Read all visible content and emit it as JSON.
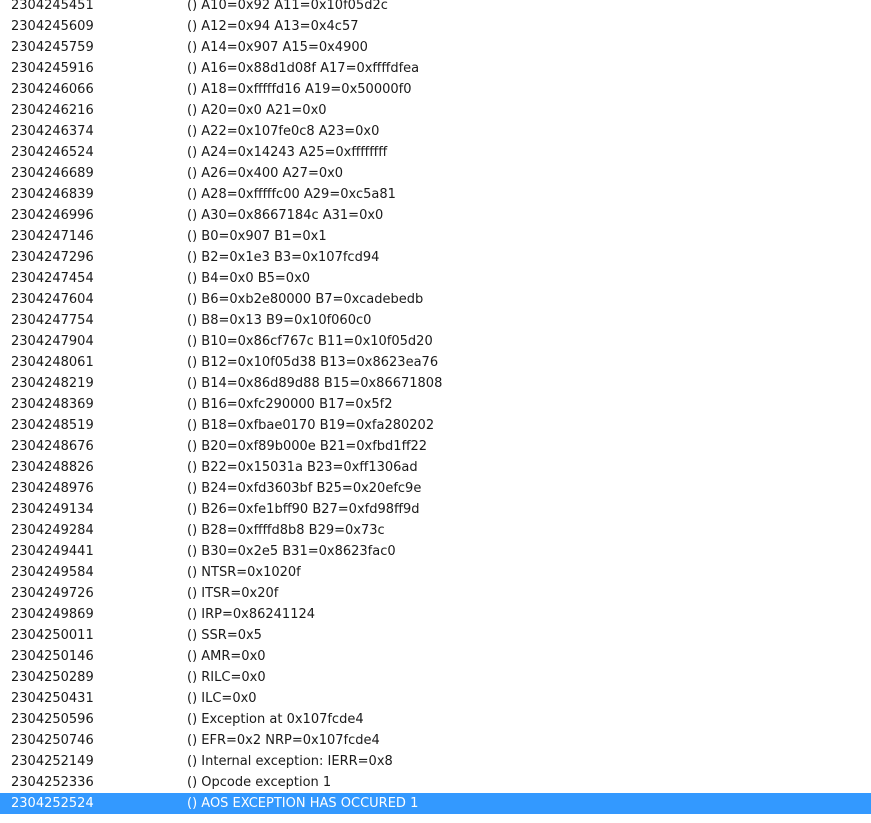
{
  "log": {
    "rows": [
      {
        "time": "2304245451",
        "message": "() A10=0x92 A11=0x10f05d2c"
      },
      {
        "time": "2304245609",
        "message": "() A12=0x94 A13=0x4c57"
      },
      {
        "time": "2304245759",
        "message": "() A14=0x907 A15=0x4900"
      },
      {
        "time": "2304245916",
        "message": "() A16=0x88d1d08f A17=0xffffdfea"
      },
      {
        "time": "2304246066",
        "message": "() A18=0xfffffd16 A19=0x50000f0"
      },
      {
        "time": "2304246216",
        "message": "() A20=0x0 A21=0x0"
      },
      {
        "time": "2304246374",
        "message": "() A22=0x107fe0c8 A23=0x0"
      },
      {
        "time": "2304246524",
        "message": "() A24=0x14243 A25=0xffffffff"
      },
      {
        "time": "2304246689",
        "message": "() A26=0x400 A27=0x0"
      },
      {
        "time": "2304246839",
        "message": "() A28=0xfffffc00 A29=0xc5a81"
      },
      {
        "time": "2304246996",
        "message": "() A30=0x8667184c A31=0x0"
      },
      {
        "time": "2304247146",
        "message": "() B0=0x907 B1=0x1"
      },
      {
        "time": "2304247296",
        "message": "() B2=0x1e3 B3=0x107fcd94"
      },
      {
        "time": "2304247454",
        "message": "() B4=0x0 B5=0x0"
      },
      {
        "time": "2304247604",
        "message": "() B6=0xb2e80000 B7=0xcadebedb"
      },
      {
        "time": "2304247754",
        "message": "() B8=0x13 B9=0x10f060c0"
      },
      {
        "time": "2304247904",
        "message": "() B10=0x86cf767c B11=0x10f05d20"
      },
      {
        "time": "2304248061",
        "message": "() B12=0x10f05d38 B13=0x8623ea76"
      },
      {
        "time": "2304248219",
        "message": "() B14=0x86d89d88 B15=0x86671808"
      },
      {
        "time": "2304248369",
        "message": "() B16=0xfc290000 B17=0x5f2"
      },
      {
        "time": "2304248519",
        "message": "() B18=0xfbae0170 B19=0xfa280202"
      },
      {
        "time": "2304248676",
        "message": "() B20=0xf89b000e B21=0xfbd1ff22"
      },
      {
        "time": "2304248826",
        "message": "() B22=0x15031a B23=0xff1306ad"
      },
      {
        "time": "2304248976",
        "message": "() B24=0xfd3603bf B25=0x20efc9e"
      },
      {
        "time": "2304249134",
        "message": "() B26=0xfe1bff90 B27=0xfd98ff9d"
      },
      {
        "time": "2304249284",
        "message": "() B28=0xffffd8b8 B29=0x73c"
      },
      {
        "time": "2304249441",
        "message": "() B30=0x2e5 B31=0x8623fac0"
      },
      {
        "time": "2304249584",
        "message": "() NTSR=0x1020f"
      },
      {
        "time": "2304249726",
        "message": "() ITSR=0x20f"
      },
      {
        "time": "2304249869",
        "message": "() IRP=0x86241124"
      },
      {
        "time": "2304250011",
        "message": "() SSR=0x5"
      },
      {
        "time": "2304250146",
        "message": "() AMR=0x0"
      },
      {
        "time": "2304250289",
        "message": "() RILC=0x0"
      },
      {
        "time": "2304250431",
        "message": "() ILC=0x0"
      },
      {
        "time": "2304250596",
        "message": "() Exception at 0x107fcde4"
      },
      {
        "time": "2304250746",
        "message": "() EFR=0x2 NRP=0x107fcde4"
      },
      {
        "time": "2304252149",
        "message": "() Internal exception: IERR=0x8"
      },
      {
        "time": "2304252336",
        "message": "() Opcode exception 1"
      },
      {
        "time": "2304252524",
        "message": "()  AOS EXCEPTION HAS OCCURED 1",
        "selected": true
      }
    ]
  },
  "colors": {
    "selection_bg": "#3399ff",
    "selection_fg": "#ffffff",
    "text": "#1a1a1a",
    "background": "#ffffff"
  }
}
